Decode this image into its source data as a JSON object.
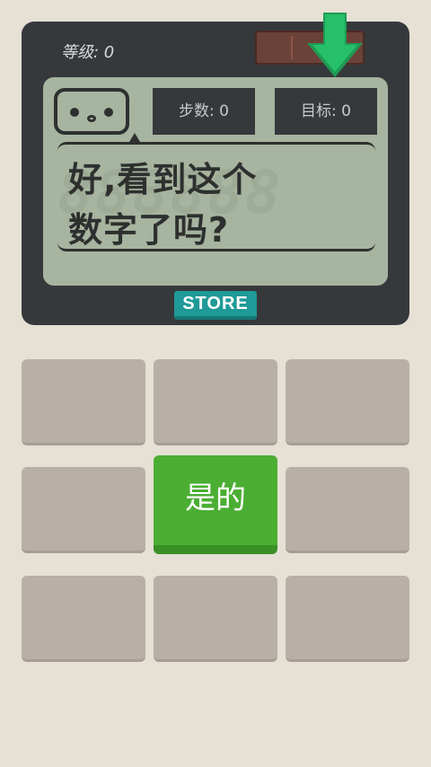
{
  "header": {
    "level_label": "等级: 0"
  },
  "screen": {
    "steps_label": "步数: 0",
    "target_label": "目标: 0",
    "message_line1": "好,看到这个",
    "message_line2": "数字了吗?",
    "ghost_digits": "888888"
  },
  "store_button": {
    "label": "STORE"
  },
  "grid": {
    "answer_label": "是的"
  },
  "colors": {
    "device": "#36393c",
    "screen": "#a7b49f",
    "accent_green": "#4bae33",
    "store_teal": "#1f9a98",
    "battery": "#6b4237"
  }
}
